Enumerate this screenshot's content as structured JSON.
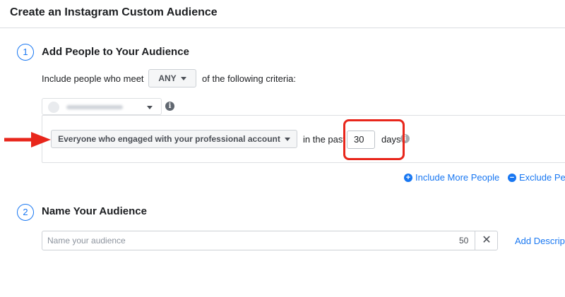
{
  "header": {
    "title": "Create an Instagram Custom Audience"
  },
  "step1": {
    "number": "1",
    "title": "Add People to Your Audience",
    "criteria_prefix": "Include people who meet",
    "match_select": "ANY",
    "criteria_suffix": "of the following criteria:",
    "engagement_select": "Everyone who engaged with your professional account",
    "in_the_past": "in the past",
    "days_value": "30",
    "days_label": "days",
    "info_glyph": "i"
  },
  "links": {
    "include_more": "Include More People",
    "include_icon": "+",
    "exclude": "Exclude Peo",
    "exclude_icon": "−"
  },
  "step2": {
    "number": "2",
    "title": "Name Your Audience",
    "name_placeholder": "Name your audience",
    "char_count": "50",
    "clear_glyph": "✕",
    "add_description": "Add Descript"
  },
  "colors": {
    "accent": "#1877f2",
    "annotation_red": "#e8261b"
  },
  "icons": [
    "info-icon",
    "caret-down-icon",
    "plus-circle-icon",
    "minus-circle-icon",
    "close-icon",
    "annotation-arrow-icon"
  ]
}
